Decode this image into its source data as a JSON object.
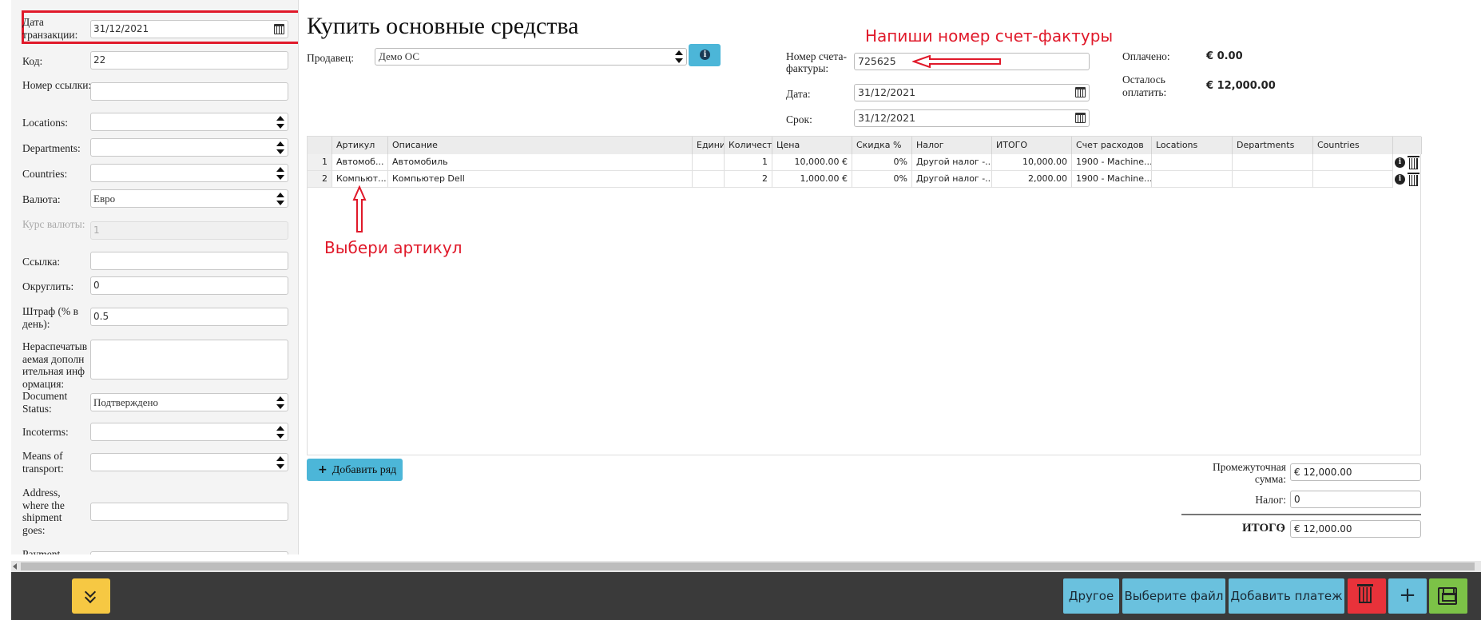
{
  "page_title": "Купить основные средства",
  "sidebar": {
    "fields": [
      {
        "key": "date",
        "label": "Дата транзакции:",
        "value": "31/12/2021",
        "type": "date"
      },
      {
        "key": "code",
        "label": "Код:",
        "value": "22",
        "type": "text"
      },
      {
        "key": "ref",
        "label": "Номер ссылки:",
        "value": "",
        "type": "text"
      },
      {
        "key": "locations",
        "label": "Locations:",
        "value": "",
        "type": "select"
      },
      {
        "key": "departments",
        "label": "Departments:",
        "value": "",
        "type": "select"
      },
      {
        "key": "countries",
        "label": "Countries:",
        "value": "",
        "type": "select"
      },
      {
        "key": "currency",
        "label": "Валюта:",
        "value": "Евро",
        "type": "select"
      },
      {
        "key": "rate",
        "label": "Курс валюты:",
        "value": "1",
        "type": "disabled"
      },
      {
        "key": "link",
        "label": "Ссылка:",
        "value": "",
        "type": "text"
      },
      {
        "key": "round",
        "label": "Округлить:",
        "value": "0",
        "type": "text"
      },
      {
        "key": "penalty",
        "label": "Штраф (% в день):",
        "value": "0.5",
        "type": "text"
      },
      {
        "key": "notes",
        "label": "Нераспечатываемая дополнительная информация:",
        "value": "",
        "type": "area"
      },
      {
        "key": "doc_status",
        "label": "Document Status:",
        "value": "Подтверждено",
        "type": "select"
      },
      {
        "key": "incoterms",
        "label": "Incoterms:",
        "value": "",
        "type": "select"
      },
      {
        "key": "transport",
        "label": "Means of transport:",
        "value": "",
        "type": "select"
      },
      {
        "key": "address",
        "label": "Address, where the shipment goes:",
        "value": "",
        "type": "text"
      },
      {
        "key": "payment",
        "label": "Payment",
        "value": "",
        "type": "text"
      }
    ]
  },
  "header": {
    "vendor_label": "Продавец:",
    "vendor_value": "Демо ОС",
    "invoice_label": "Номер счета-фактуры:",
    "invoice_value": "725625",
    "date_label": "Дата:",
    "date_value": "31/12/2021",
    "due_label": "Срок:",
    "due_value": "31/12/2021",
    "paid_label": "Оплачено:",
    "paid_value": "€ 0.00",
    "remaining_label": "Осталось оплатить:",
    "remaining_value": "€ 12,000.00",
    "annotation_invoice": "Напиши номер счет-фактуры",
    "annotation_article": "Выбери артикул"
  },
  "grid": {
    "columns": [
      "Артикул",
      "Описание",
      "Единиц",
      "Количество",
      "Цена",
      "Скидка %",
      "Налог",
      "ИТОГО",
      "Счет расходов",
      "Locations",
      "Departments",
      "Countries"
    ],
    "rows": [
      {
        "num": "1",
        "article": "Автомоб...",
        "description": "Автомобиль",
        "unit": "",
        "qty": "1",
        "price": "10,000.00 €",
        "discount": "0%",
        "tax": "Другой налог -...",
        "total": "10,000.00",
        "account": "1900 - Machine...",
        "locations": "",
        "departments": "",
        "countries": ""
      },
      {
        "num": "2",
        "article": "Компьют...",
        "description": "Компьютер Dell",
        "unit": "",
        "qty": "2",
        "price": "1,000.00 €",
        "discount": "0%",
        "tax": "Другой налог -...",
        "total": "2,000.00",
        "account": "1900 - Machine...",
        "locations": "",
        "departments": "",
        "countries": ""
      }
    ]
  },
  "add_row_label": "Добавить ряд",
  "totals": {
    "subtotal_label": "Промежуточная сумма:",
    "subtotal_value": "€ 12,000.00",
    "tax_label": "Налог:",
    "tax_value": "0",
    "total_label": "ИТОГО",
    "total_value": "€ 12,000.00"
  },
  "toolbar": {
    "other_label": "Другое",
    "file_label": "Выберите файл",
    "payment_label": "Добавить платеж",
    "icons": [
      "chevron-double-down-icon",
      "trash-icon",
      "plus-icon",
      "save-icon"
    ]
  },
  "colors": {
    "accent": "#4cb6d8",
    "annotation": "#e0192a",
    "collapse": "#f6c843",
    "delete": "#e8323a",
    "save": "#7cc247"
  }
}
